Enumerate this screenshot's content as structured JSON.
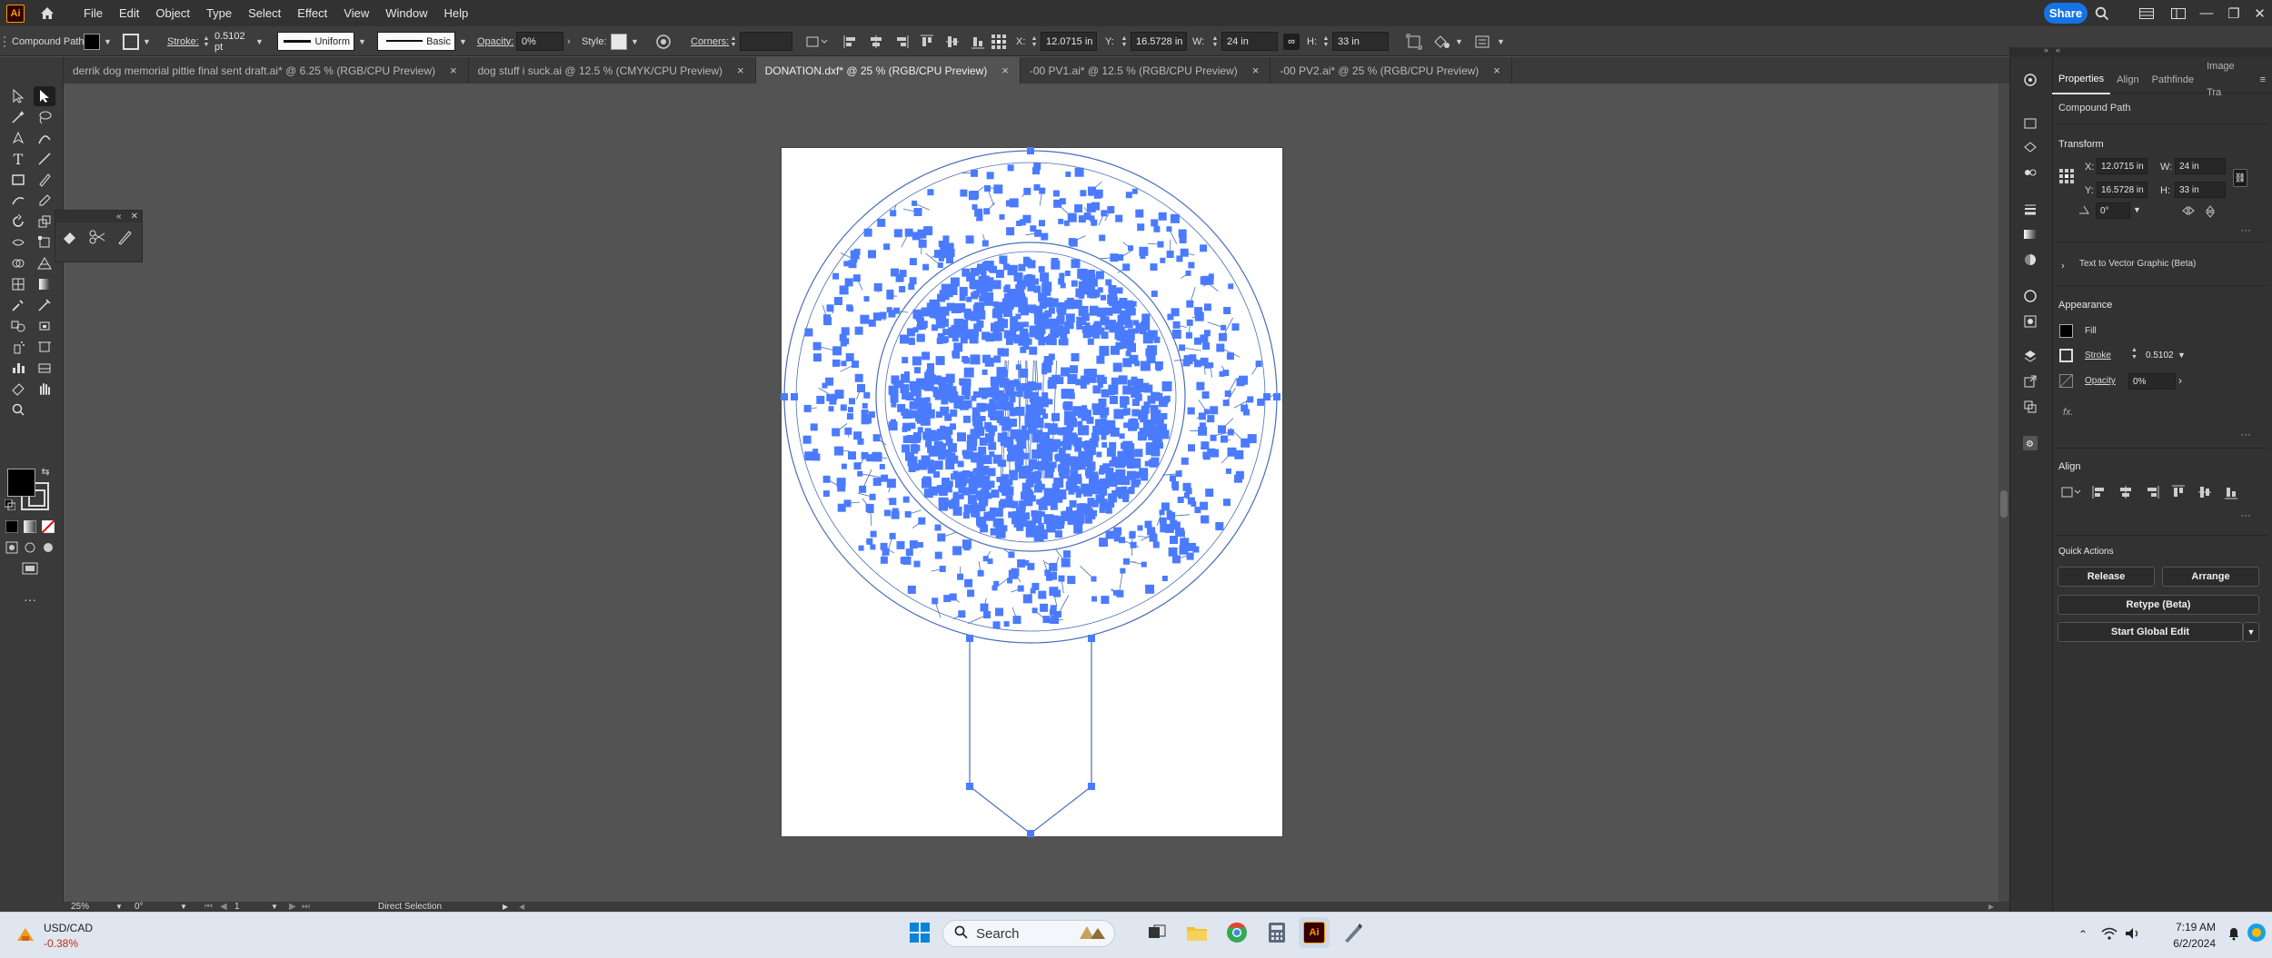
{
  "app": {
    "logo": "Ai",
    "menus": [
      "File",
      "Edit",
      "Object",
      "Type",
      "Select",
      "Effect",
      "View",
      "Window",
      "Help"
    ],
    "share_label": "Share"
  },
  "control_bar": {
    "selection_type": "Compound Path",
    "stroke_label": "Stroke:",
    "stroke_weight": "0.5102 pt",
    "profile": "Uniform",
    "brush": "Basic",
    "opacity_label": "Opacity:",
    "opacity_value": "0%",
    "style_label": "Style:",
    "corners_label": "Corners:",
    "x_label": "X:",
    "x_value": "12.0715 in",
    "y_label": "Y:",
    "y_value": "16.5728 in",
    "w_label": "W:",
    "w_value": "24 in",
    "h_label": "H:",
    "h_value": "33 in"
  },
  "tabs": [
    {
      "label": "derrik dog memorial pittie final sent draft.ai* @ 6.25 % (RGB/CPU Preview)",
      "active": false
    },
    {
      "label": "dog stuff i suck.ai @ 12.5 % (CMYK/CPU Preview)",
      "active": false
    },
    {
      "label": "DONATION.dxf* @ 25 % (RGB/CPU Preview)",
      "active": true
    },
    {
      "label": "-00 PV1.ai* @ 12.5 % (RGB/CPU Preview)",
      "active": false
    },
    {
      "label": "-00 PV2.ai* @ 25 % (RGB/CPU Preview)",
      "active": false
    }
  ],
  "status": {
    "zoom": "25%",
    "rotation": "0°",
    "artboard": "1",
    "tool": "Direct Selection"
  },
  "properties": {
    "tabs": [
      "Properties",
      "Align",
      "Pathfinde",
      "Image Tra"
    ],
    "object_type": "Compound Path",
    "transform_title": "Transform",
    "x_label": "X:",
    "x_value": "12.0715 in",
    "y_label": "Y:",
    "y_value": "16.5728 in",
    "w_label": "W:",
    "w_value": "24 in",
    "h_label": "H:",
    "h_value": "33 in",
    "angle_value": "0°",
    "text_to_vector": "Text to Vector Graphic (Beta)",
    "appearance_title": "Appearance",
    "fill_label": "Fill",
    "stroke_label": "Stroke",
    "stroke_value": "0.5102",
    "opacity_label": "Opacity",
    "opacity_value": "0%",
    "fx_label": "fx.",
    "align_title": "Align",
    "quick_actions_title": "Quick Actions",
    "release_label": "Release",
    "arrange_label": "Arrange",
    "retype_label": "Retype (Beta)",
    "global_edit_label": "Start Global Edit"
  },
  "taskbar": {
    "ticker_name": "USD/CAD",
    "ticker_change": "-0.38%",
    "search_placeholder": "Search",
    "time": "7:19 AM",
    "date": "6/2/2024"
  },
  "colors": {
    "selection": "#4a7bff",
    "share": "#1473e6",
    "ticker_negative": "#c42b1c"
  }
}
